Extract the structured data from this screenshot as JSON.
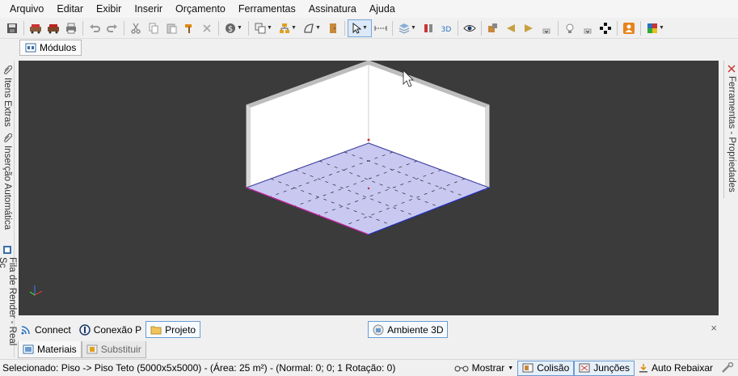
{
  "menu": [
    "Arquivo",
    "Editar",
    "Exibir",
    "Inserir",
    "Orçamento",
    "Ferramentas",
    "Assinatura",
    "Ajuda"
  ],
  "modulos_tab": "Módulos",
  "left_panel": {
    "itens_extras": "Itens Extras",
    "insercao_automatica": "Inserção Automática",
    "fila_render": "Fila de Render - Real Sc"
  },
  "right_panel": {
    "ferramentas": "Ferramentas - Propriedades"
  },
  "bottom_tabs": {
    "connect": "Connect",
    "conexao": "Conexão P",
    "projeto": "Projeto",
    "ambiente": "Ambiente 3D",
    "close": "×"
  },
  "material_tabs": {
    "materiais": "Materiais",
    "substituir": "Substituir"
  },
  "status": {
    "text": "Selecionado: Piso -> Piso Teto (5000x5x5000) - (Área: 25 m²) - (Normal: 0; 0; 1 Rotação: 0)",
    "mostrar": "Mostrar",
    "colisao": "Colisão",
    "juncoes": "Junções",
    "auto_rebaixar": "Auto Rebaixar"
  },
  "colors": {
    "viewport_bg": "#3b3b3b",
    "floor": "#c8c8f0",
    "wall": "#ffffff",
    "accent": "#6a9bd1"
  }
}
